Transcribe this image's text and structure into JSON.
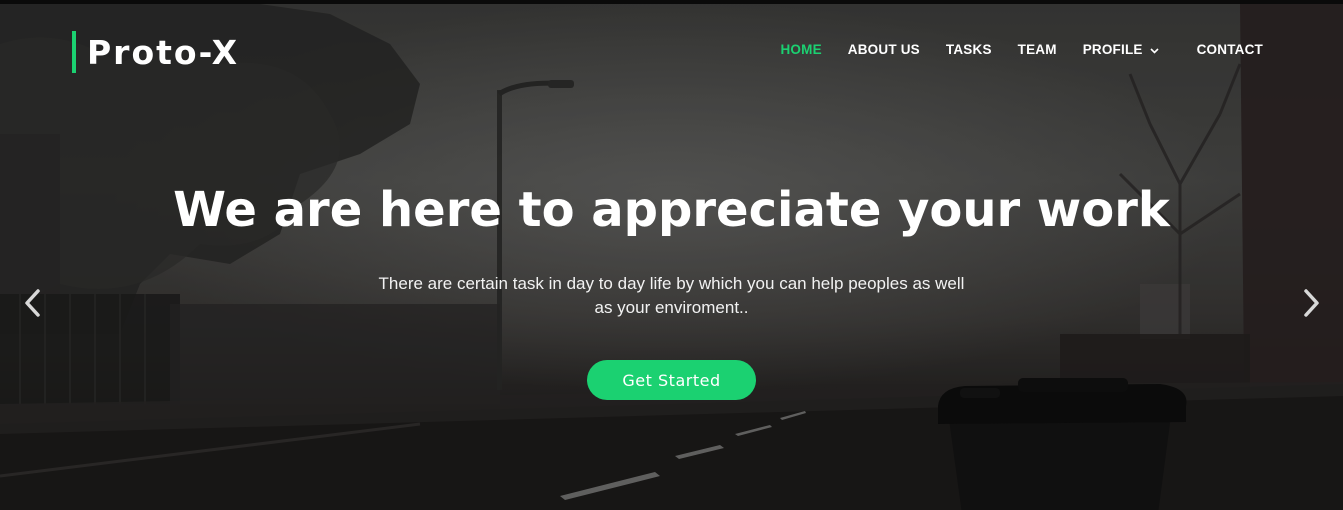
{
  "brand": {
    "name": "Proto-X",
    "accent_color": "#1bd171"
  },
  "nav": {
    "items": [
      {
        "label": "HOME",
        "active": true
      },
      {
        "label": "ABOUT US",
        "active": false
      },
      {
        "label": "TASKS",
        "active": false
      },
      {
        "label": "TEAM",
        "active": false
      },
      {
        "label": "PROFILE",
        "active": false,
        "has_dropdown": true,
        "icon": "chevron-down-icon"
      },
      {
        "label": "CONTACT",
        "active": false
      }
    ]
  },
  "hero": {
    "title": "We are here to appreciate your work",
    "subtitle": "There are certain task in day to day life by which you can help peoples as well as your enviroment..",
    "cta_label": "Get Started",
    "cta_color": "#1bd171",
    "prev_icon": "chevron-left-icon",
    "next_icon": "chevron-right-icon"
  }
}
